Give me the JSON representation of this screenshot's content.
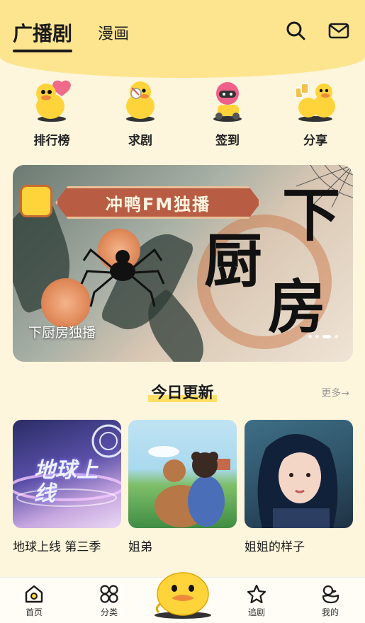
{
  "header": {
    "tabs": [
      {
        "label": "广播剧",
        "active": true
      },
      {
        "label": "漫画",
        "active": false
      }
    ],
    "icons": [
      "search-icon",
      "mail-icon"
    ]
  },
  "shortcuts": [
    {
      "label": "排行榜",
      "icon": "duck-heart-icon"
    },
    {
      "label": "求剧",
      "icon": "duck-pray-icon"
    },
    {
      "label": "签到",
      "icon": "duck-helmet-icon"
    },
    {
      "label": "分享",
      "icon": "duck-cheers-icon"
    }
  ],
  "banner": {
    "strip_text": "冲鸭FM独播",
    "big_text": [
      "下",
      "厨",
      "房"
    ],
    "caption": "下厨房独播",
    "page_count": 4,
    "active_index": 2
  },
  "today": {
    "title": "今日更新",
    "more": "更多→",
    "items": [
      {
        "title": "地球上线 第三季",
        "cover_text": "地球上线"
      },
      {
        "title": "姐弟"
      },
      {
        "title": "姐姐的样子"
      }
    ]
  },
  "nav": {
    "items": [
      {
        "label": "首页",
        "icon": "home-icon"
      },
      {
        "label": "分类",
        "icon": "category-icon"
      },
      {
        "label": "追剧",
        "icon": "star-icon"
      },
      {
        "label": "我的",
        "icon": "profile-duck-icon"
      }
    ],
    "center_icon": "duck-mascot-icon"
  },
  "colors": {
    "accent": "#fde58f",
    "background": "#fdf6dc",
    "highlight": "#ffe066"
  }
}
